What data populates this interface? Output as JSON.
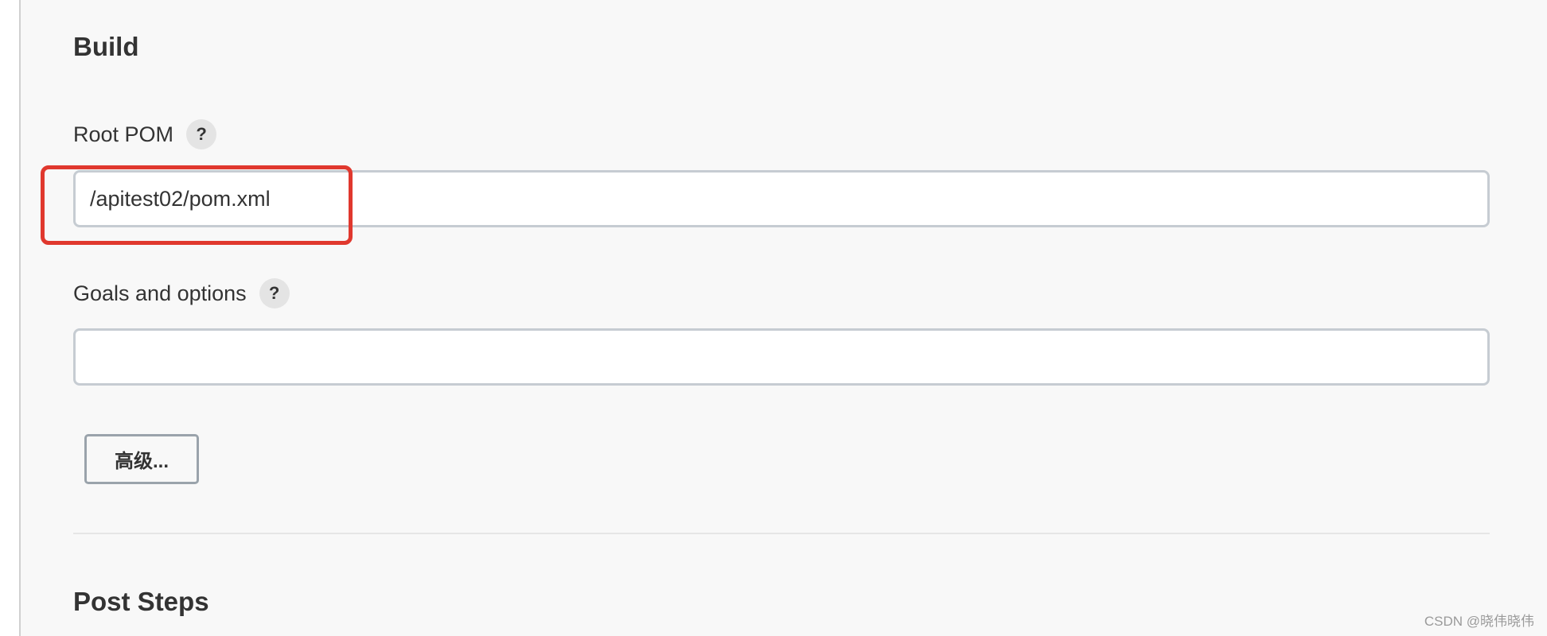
{
  "build_section": {
    "title": "Build",
    "root_pom": {
      "label": "Root POM",
      "help_label": "?",
      "value": "/apitest02/pom.xml"
    },
    "goals_and_options": {
      "label": "Goals and options",
      "help_label": "?",
      "value": ""
    },
    "advanced_button_label": "高级..."
  },
  "post_steps_section": {
    "title": "Post Steps"
  },
  "watermark": "CSDN @晓伟晓伟",
  "colors": {
    "highlight": "#e0382e",
    "panel_background": "#f8f8f8",
    "input_border": "#c6ccd2"
  }
}
